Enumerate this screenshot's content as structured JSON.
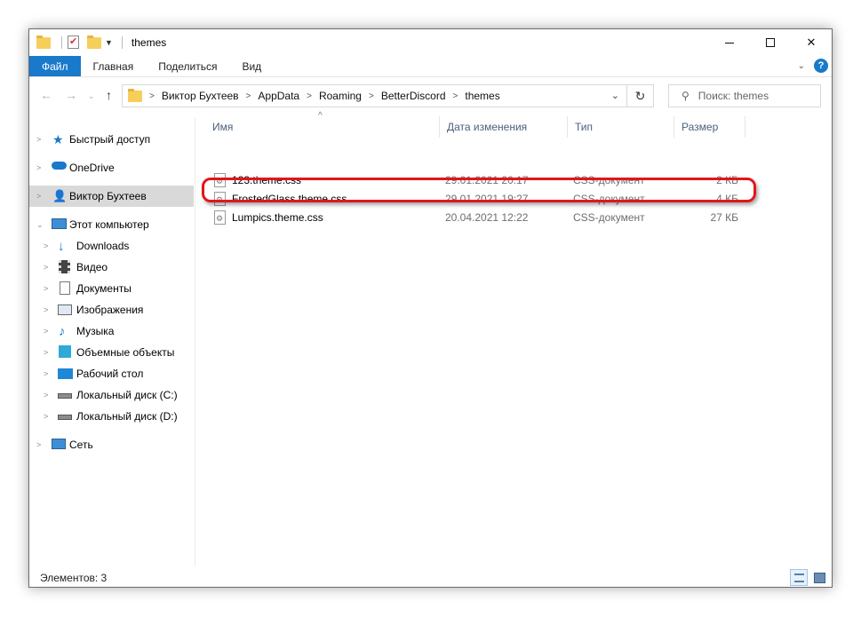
{
  "window": {
    "title": "themes"
  },
  "ribbon": {
    "tabs": [
      "Файл",
      "Главная",
      "Поделиться",
      "Вид"
    ],
    "help_label": "?"
  },
  "address": {
    "crumbs": [
      "Виктор Бухтеев",
      "AppData",
      "Roaming",
      "BetterDiscord",
      "themes"
    ]
  },
  "search": {
    "placeholder": "Поиск: themes"
  },
  "nav": {
    "quick_access": "Быстрый доступ",
    "onedrive": "OneDrive",
    "user": "Виктор Бухтеев",
    "this_pc": "Этот компьютер",
    "downloads": "Downloads",
    "video": "Видео",
    "documents": "Документы",
    "pictures": "Изображения",
    "music": "Музыка",
    "objects3d": "Объемные объекты",
    "desktop": "Рабочий стол",
    "disk_c": "Локальный диск (C:)",
    "disk_d": "Локальный диск (D:)",
    "network": "Сеть"
  },
  "columns": {
    "name": "Имя",
    "date": "Дата изменения",
    "type": "Тип",
    "size": "Размер"
  },
  "files": [
    {
      "name": "123.theme.css",
      "date": "29.01.2021 20:17",
      "type": "CSS-документ",
      "size": "2 КБ"
    },
    {
      "name": "FrostedGlass.theme.css",
      "date": "29.01.2021 19:27",
      "type": "CSS-документ",
      "size": "4 КБ"
    },
    {
      "name": "Lumpics.theme.css",
      "date": "20.04.2021 12:22",
      "type": "CSS-документ",
      "size": "27 КБ"
    }
  ],
  "status": {
    "items_count": "Элементов: 3"
  },
  "colors": {
    "accent": "#1979ca",
    "highlight": "#e2161a",
    "selection": "#d9d9d9"
  }
}
